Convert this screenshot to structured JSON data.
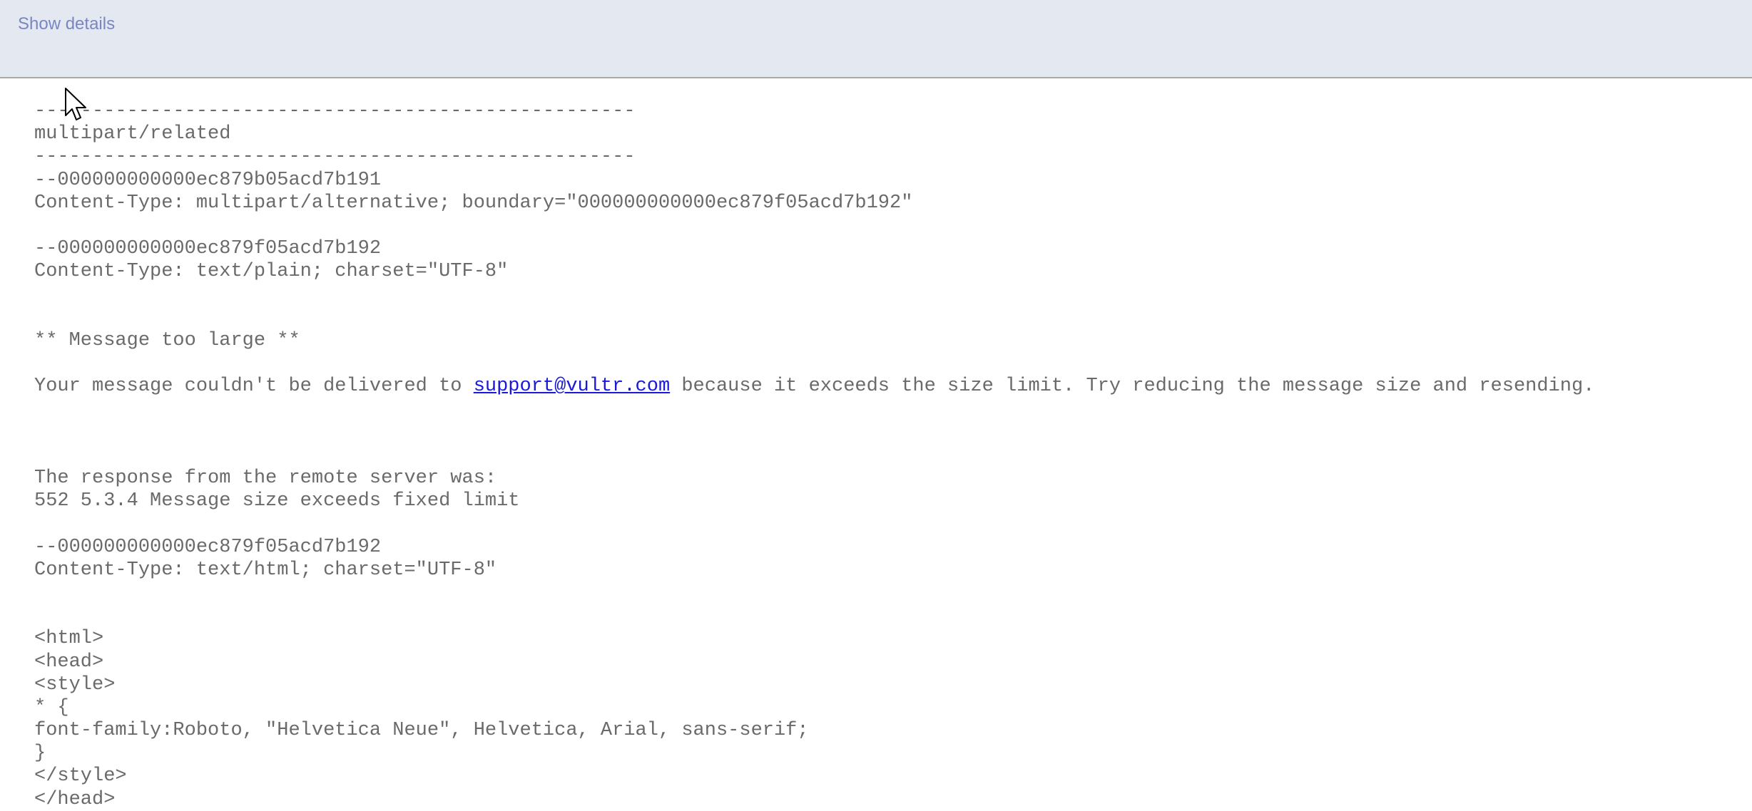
{
  "header": {
    "show_details_label": "Show details"
  },
  "message": {
    "lines": [
      "----------------------------------------------------",
      "multipart/related",
      "----------------------------------------------------",
      "--000000000000ec879b05acd7b191",
      "Content-Type: multipart/alternative; boundary=\"000000000000ec879f05acd7b192\"",
      "",
      "--000000000000ec879f05acd7b192",
      "Content-Type: text/plain; charset=\"UTF-8\"",
      "",
      "",
      "** Message too large **",
      "",
      "",
      "",
      "",
      "",
      "The response from the remote server was:",
      "552 5.3.4 Message size exceeds fixed limit",
      "",
      "--000000000000ec879f05acd7b192",
      "Content-Type: text/html; charset=\"UTF-8\"",
      "",
      "",
      "<html>",
      "<head>",
      "<style>",
      "* {",
      "font-family:Roboto, \"Helvetica Neue\", Helvetica, Arial, sans-serif;",
      "}",
      "</style>",
      "</head>"
    ],
    "delivery_line": {
      "prefix": "Your message couldn't be delivered to ",
      "email_link": "support@vultr.com",
      "suffix": " because it exceeds the size limit. Try reducing the message size and resending."
    }
  },
  "icons": {
    "cursor": "mouse-pointer-icon"
  }
}
